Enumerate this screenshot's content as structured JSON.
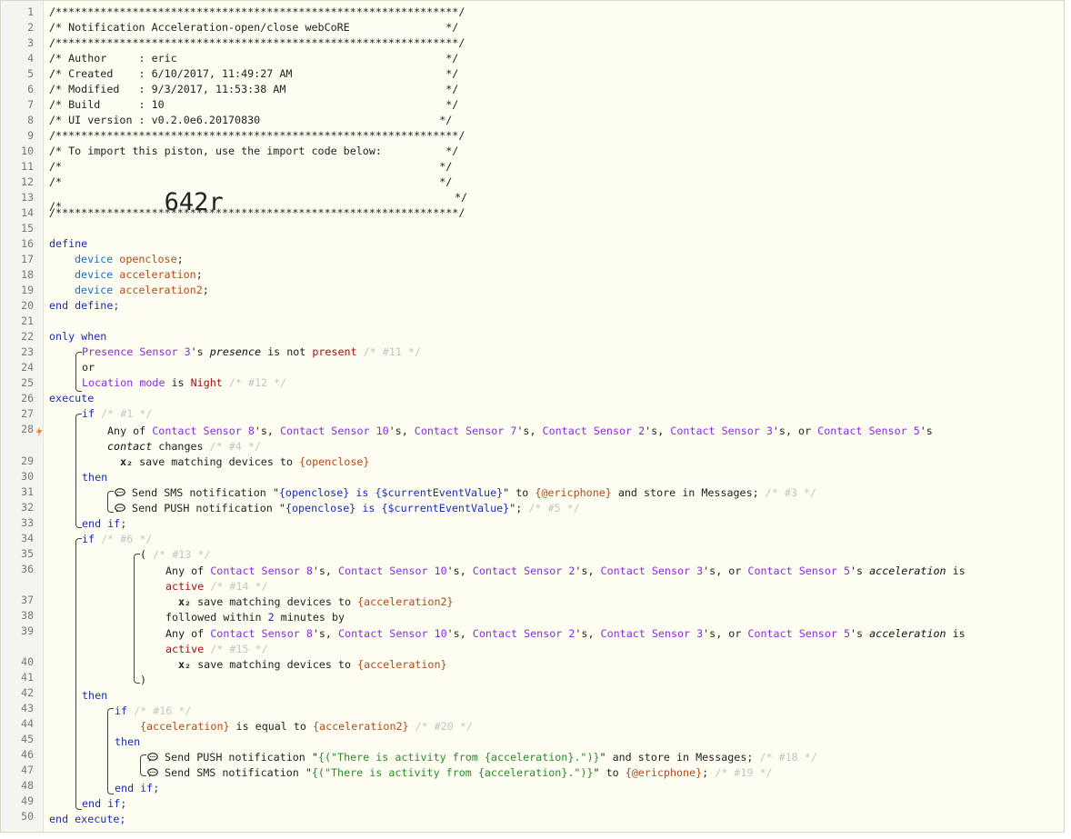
{
  "header": {
    "stars": "/***************************************************************/",
    "title_line": "/* Notification Acceleration-open/close webCoRE               */",
    "author_line": "/* Author     : eric                                          */",
    "created_line": "/* Created    : 6/10/2017, 11:49:27 AM                        */",
    "modified_line": "/* Modified   : 9/3/2017, 11:53:38 AM                         */",
    "build_line": "/* Build      : 10                                            */",
    "ui_line": "/* UI version : v0.2.0e6.20170830                            */",
    "import_line": "/* To import this piston, use the import code below:          */",
    "blank_line": "/*                                                           */",
    "code_prefix": "/*                ",
    "import_code": "642r",
    "code_suffix": "                                       */"
  },
  "code": {
    "define": "define",
    "device": "device",
    "dev_openclose": "openclose",
    "dev_acceleration": "acceleration",
    "dev_acceleration2": "acceleration2",
    "end_define": "end define;",
    "only_when": "only when",
    "presence_sensor": "Presence Sensor 3",
    "s": "'s ",
    "presence": "presence",
    "is_not": " is not ",
    "present": "present",
    "c11": "/* #11 */",
    "or": "or",
    "location_mode": "Location mode",
    "is": " is ",
    "night": "Night",
    "c12": "/* #12 */",
    "execute": "execute",
    "if": "if",
    "then": "then",
    "end_if": "end if;",
    "c1": "/* #1 */",
    "any_of": "Any of ",
    "cs8": "Contact Sensor 8",
    "cs10": "Contact Sensor 10",
    "cs7": "Contact Sensor 7",
    "cs2": "Contact Sensor 2",
    "cs3": "Contact Sensor 3",
    "cs5": "Contact Sensor 5",
    "sep": "'s, ",
    "or_sep": "'s, or ",
    "s_end": "'s",
    "contact": "contact",
    "changes": " changes ",
    "c4": "/* #4 */",
    "x2": "x₂",
    "save_matching": " save matching devices to ",
    "v_openclose": "{openclose}",
    "v_acceleration": "{acceleration}",
    "v_acceleration2": "{acceleration2}",
    "send_sms": " Send SMS notification \"",
    "send_push": " Send PUSH notification \"",
    "openclose_msg": "{openclose} is {$currentEventValue}",
    "q_to": "\" to ",
    "ericphone": "{@ericphone}",
    "store_msg": " and store in Messages; ",
    "c3": "/* #3 */",
    "q_end": "\"; ",
    "c5": "/* #5 */",
    "c6": "/* #6 */",
    "paren_open": "( ",
    "c13": "/* #13 */",
    "acceleration_attr": "acceleration",
    "is_word": " is",
    "active": "active",
    "c14": "/* #14 */",
    "followed_within": "followed within ",
    "two": "2",
    "minutes_by": " minutes by",
    "c15": "/* #15 */",
    "paren_close": ")",
    "c16": "/* #16 */",
    "is_equal_to": " is equal to ",
    "c20": "/* #20 */",
    "activity_msg": "{(\"There is activity from {acceleration}.\")}",
    "q_store": "\" and store in Messages; ",
    "c18": "/* #18 */",
    "c19": "/* #19 */",
    "end_execute": "end execute;"
  },
  "line_numbers": [
    "1",
    "2",
    "3",
    "4",
    "5",
    "6",
    "7",
    "8",
    "9",
    "10",
    "11",
    "12",
    "13",
    "14",
    "15",
    "16",
    "17",
    "18",
    "19",
    "20",
    "21",
    "22",
    "23",
    "24",
    "25",
    "26",
    "27",
    "28",
    "29",
    "30",
    "31",
    "32",
    "33",
    "34",
    "35",
    "36",
    "37",
    "38",
    "39",
    "40",
    "41",
    "42",
    "43",
    "44",
    "45",
    "46",
    "47",
    "48",
    "49",
    "50"
  ],
  "line_number_rows": [
    0,
    1,
    2,
    3,
    4,
    5,
    6,
    7,
    8,
    9,
    10,
    11,
    12,
    13,
    14,
    15,
    16,
    17,
    18,
    19,
    20,
    21,
    22,
    23,
    24,
    25,
    26,
    27,
    29,
    30,
    31,
    32,
    33,
    34,
    35,
    36,
    38,
    39,
    40,
    42,
    43,
    44,
    45,
    46,
    47,
    48,
    49,
    50,
    51,
    52
  ],
  "icons": {
    "trigger": "lightning-bolt-icon",
    "notification": "speech-bubble-icon"
  },
  "colors": {
    "keyword": "#1a2bb5",
    "device_keyword": "#1a6fbf",
    "variable": "#b34a1a",
    "device_name": "#8a2be2",
    "value": "#a01010",
    "comment": "#c4c4c4",
    "expression_string": "#2a8a2a",
    "trigger_bolt": "#f08030"
  }
}
